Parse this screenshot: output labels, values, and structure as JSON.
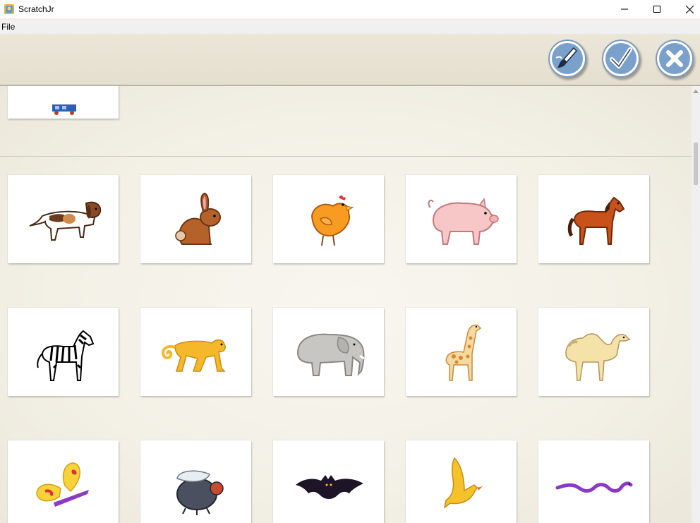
{
  "window": {
    "title": "ScratchJr",
    "controls": [
      "minimize-icon",
      "maximize-icon",
      "close-icon"
    ]
  },
  "menu": {
    "file": "File"
  },
  "toolbar": {
    "buttons": [
      "paintbrush-icon",
      "checkmark-icon",
      "x-icon"
    ],
    "button_color": "#6f93c0"
  },
  "library": {
    "rows": [
      [
        "dog",
        "rabbit",
        "chicken",
        "pig",
        "horse"
      ],
      [
        "zebra",
        "monkey",
        "elephant",
        "giraffe",
        "camel"
      ],
      [
        "butterfly",
        "fly",
        "bat",
        "bird",
        "snake"
      ]
    ]
  }
}
